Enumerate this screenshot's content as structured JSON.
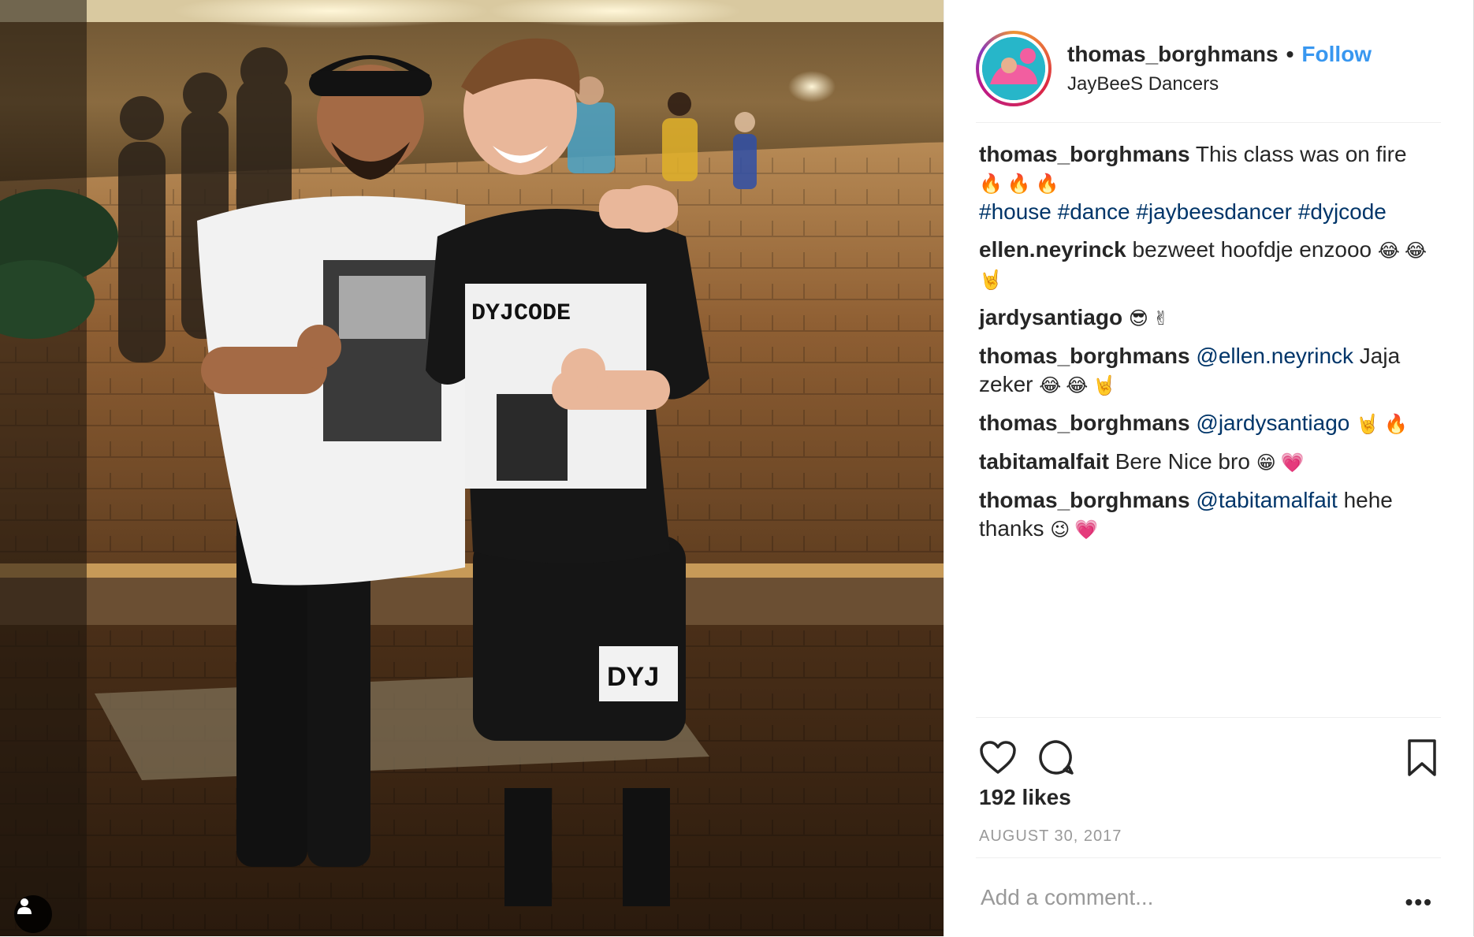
{
  "post": {
    "username": "thomas_borghmans",
    "separator": "•",
    "follow_label": "Follow",
    "location": "JayBeeS Dancers",
    "likes": "192 likes",
    "date": "AUGUST 30, 2017",
    "comment_placeholder": "Add a comment...",
    "more_label": "•••"
  },
  "comments": [
    {
      "user": "thomas_borghmans",
      "text": "This class was on fire",
      "emoji": "🔥🔥🔥",
      "tags": [
        "#house",
        "#dance",
        "#jaybeesdancer",
        "#dyjcode"
      ]
    },
    {
      "user": "ellen.neyrinck",
      "text": "bezweet hoofdje enzooo",
      "emoji": "😂😂🤘"
    },
    {
      "user": "jardysantiago",
      "text": "",
      "emoji": "😎✌"
    },
    {
      "user": "thomas_borghmans",
      "mention": "@ellen.neyrinck",
      "text": "Jaja zeker",
      "emoji": "😂😂🤘"
    },
    {
      "user": "thomas_borghmans",
      "mention": "@jardysantiago",
      "text": "",
      "emoji": "🤘🔥"
    },
    {
      "user": "tabitamalfait",
      "text": "Bere Nice bro",
      "emoji": "😁💗"
    },
    {
      "user": "thomas_borghmans",
      "mention": "@tabitamalfait",
      "text": "hehe thanks",
      "emoji": "😉💗"
    }
  ],
  "icons": {
    "like": "heart-icon",
    "comment": "speech-bubble-icon",
    "save": "bookmark-icon",
    "tag": "user-tag-icon"
  },
  "colors": {
    "follow": "#3897f0",
    "hashtag": "#003569",
    "muted": "#999999",
    "text": "#262626"
  },
  "photo_text": {
    "shirt_logo": "DYJCODE",
    "shorts_logo": "DYJ"
  }
}
